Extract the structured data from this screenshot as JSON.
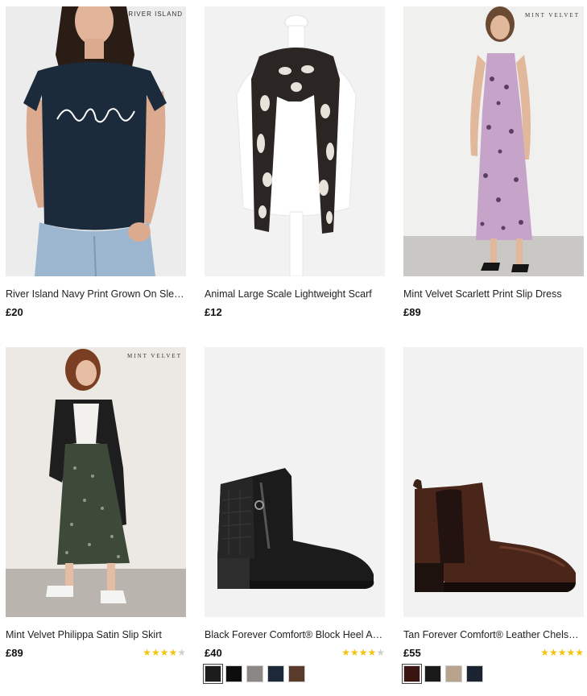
{
  "products": [
    {
      "brand": "RIVER ISLAND",
      "title": "River Island Navy Print Grown On Slee…",
      "price": "£20",
      "image_icon": "navy-tshirt-model-photo"
    },
    {
      "brand": "",
      "title": "Animal Large Scale Lightweight Scarf",
      "price": "£12",
      "image_icon": "animal-print-scarf-photo"
    },
    {
      "brand": "MINT VELVET",
      "title": "Mint Velvet Scarlett Print Slip Dress",
      "price": "£89",
      "image_icon": "print-slip-dress-photo"
    },
    {
      "brand": "MINT VELVET",
      "title": "Mint Velvet Philippa Satin Slip Skirt",
      "price": "£89",
      "rating": 4,
      "rating_max": 5,
      "image_icon": "satin-slip-skirt-photo"
    },
    {
      "brand": "",
      "title": "Black Forever Comfort® Block Heel An…",
      "price": "£40",
      "rating": 4,
      "rating_max": 5,
      "swatches": [
        "#1c1c1c",
        "#0d0d0d",
        "#8a8785",
        "#1d2838",
        "#5a3a2a"
      ],
      "image_icon": "black-ankle-boot-photo"
    },
    {
      "brand": "",
      "title": "Tan Forever Comfort® Leather Chelsea…",
      "price": "£55",
      "rating": 5,
      "rating_max": 5,
      "swatches": [
        "#3a1410",
        "#1a1a1a",
        "#b8a48e",
        "#1b2230"
      ],
      "image_icon": "tan-chelsea-boot-photo"
    }
  ],
  "colors": {
    "star_on": "#f1c40f",
    "star_off": "#cfcfcf",
    "text": "#222222"
  }
}
